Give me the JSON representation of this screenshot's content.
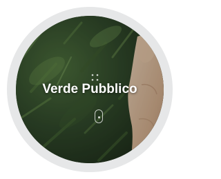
{
  "widget": {
    "title": "Verde Pubblico",
    "center_icon": "grid-dots-icon",
    "action_icon": "pill-button-icon",
    "colors": {
      "ring": "#e6e7e8",
      "title": "#ffffff",
      "foliage": "#2f3f2a",
      "skin": "#d8b79a"
    }
  }
}
